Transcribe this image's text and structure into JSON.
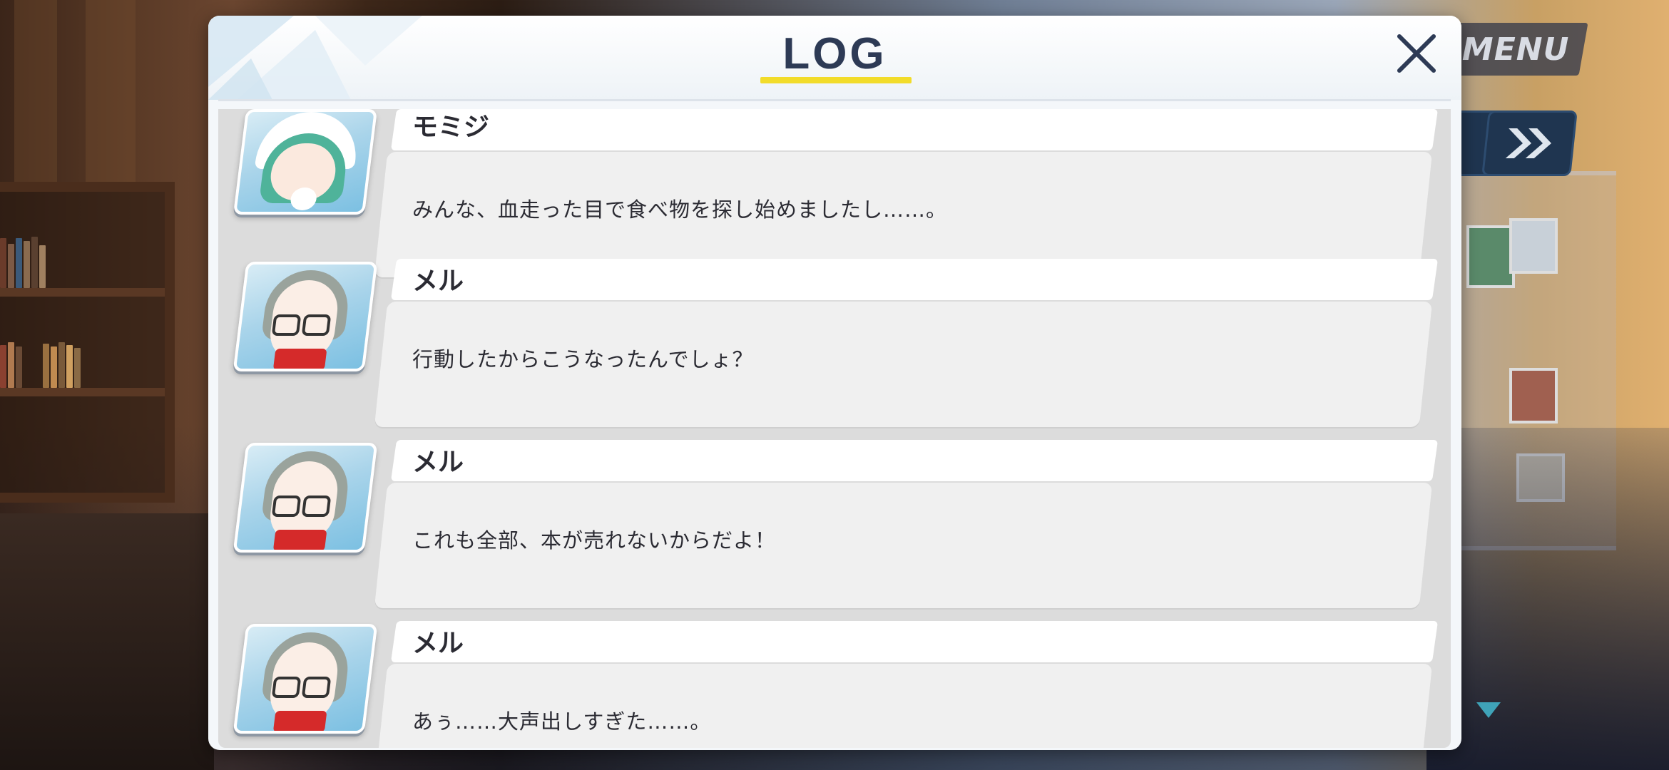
{
  "hud": {
    "menu_label": "MENU",
    "fast_forward_icon": "double-chevron-right-icon"
  },
  "log": {
    "title": "LOG",
    "close_icon": "close-icon",
    "accent_color": "#f2dc2a",
    "title_color": "#2d3a55",
    "entries": [
      {
        "speaker": "モミジ",
        "text": "みんな、血走った目で食べ物を探し始めましたし……。",
        "portrait": "momiji-portrait"
      },
      {
        "speaker": "メル",
        "text": "行動したからこうなったんでしょ？",
        "portrait": "meru-portrait"
      },
      {
        "speaker": "メル",
        "text": "これも全部、本が売れないからだよ！",
        "portrait": "meru-portrait"
      },
      {
        "speaker": "メル",
        "text": "あぅ……大声出しすぎた……。",
        "portrait": "meru-portrait"
      }
    ]
  }
}
